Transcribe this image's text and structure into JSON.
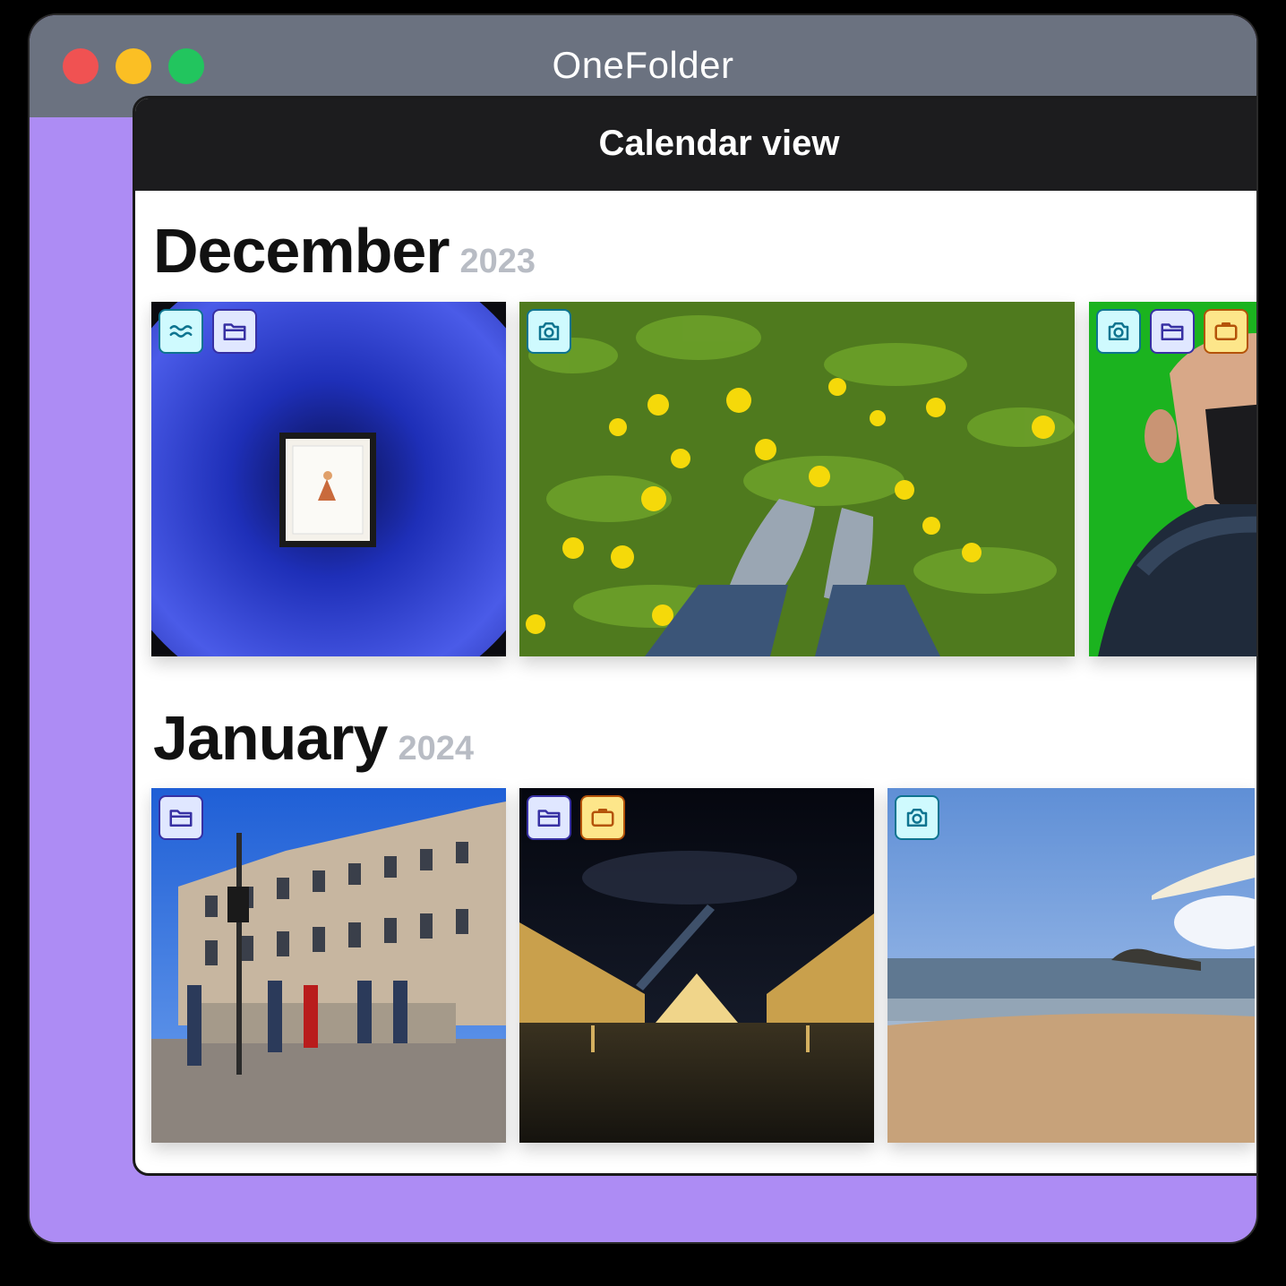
{
  "window": {
    "title": "OneFolder"
  },
  "panel": {
    "title": "Calendar view"
  },
  "sections": [
    {
      "month": "December",
      "year": "2023",
      "photos": [
        {
          "scene": "framed-art-blue-wall",
          "tags": [
            "waves-icon",
            "folder-icon"
          ]
        },
        {
          "scene": "dandelion-field-feet",
          "tags": [
            "camera-icon"
          ]
        },
        {
          "scene": "masked-person-green-screen",
          "tags": [
            "camera-icon",
            "folder-icon",
            "briefcase-icon"
          ]
        }
      ]
    },
    {
      "month": "January",
      "year": "2024",
      "photos": [
        {
          "scene": "city-square-people",
          "tags": [
            "folder-icon"
          ]
        },
        {
          "scene": "louvre-pyramid-night",
          "tags": [
            "folder-icon",
            "briefcase-icon"
          ]
        },
        {
          "scene": "beach-seaside",
          "tags": [
            "camera-icon"
          ]
        }
      ]
    }
  ],
  "colors": {
    "window_bg": "#ad8cf4",
    "titlebar": "#6b7280",
    "header": "#1c1c1e",
    "tag_cyan": "#cffafe",
    "tag_indigo": "#e0e7ff",
    "tag_amber": "#fde68a"
  }
}
